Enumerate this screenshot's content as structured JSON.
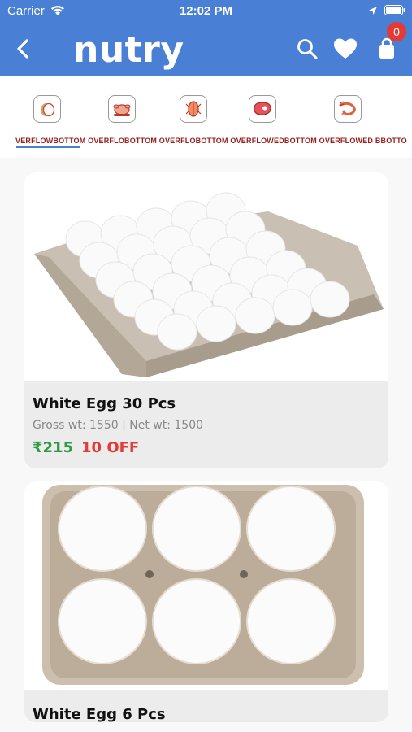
{
  "status": {
    "carrier": "Carrier",
    "time": "12:02 PM"
  },
  "header": {
    "title": "nutry",
    "cart_count": "0",
    "icons": [
      "back-icon",
      "search-icon",
      "heart-icon",
      "bag-icon"
    ]
  },
  "categories": {
    "items": [
      {
        "icon": "egg-icon",
        "overflow_text": "VERFLOWBOTTOM"
      },
      {
        "icon": "chicken-icon",
        "overflow_text": "OVERFLOBOTTOM"
      },
      {
        "icon": "fish-icon",
        "overflow_text": "OVERFLOBOTTOM"
      },
      {
        "icon": "meat-icon",
        "overflow_text": "OVERFLOWEDBOTTOM"
      },
      {
        "icon": "prawn-icon",
        "overflow_text": "OVERFLOWED BBOTTO"
      }
    ],
    "overflow_line": "VERFLOWBOTTOM OVERFLOBOTTOM OVERFLOBOTTOM OVERFLOWEDBOTTOM OVERFLOWED BBOTTO"
  },
  "products": [
    {
      "name": "White Egg 30 Pcs",
      "weight": "Gross wt: 1550 | Net wt: 1500",
      "price": "₹215",
      "offer": "10 OFF"
    },
    {
      "name": "White Egg 6 Pcs"
    }
  ],
  "colors": {
    "brand": "#4a7fd6",
    "price": "#2e9b44",
    "offer": "#e53935",
    "badge": "#e53935"
  }
}
